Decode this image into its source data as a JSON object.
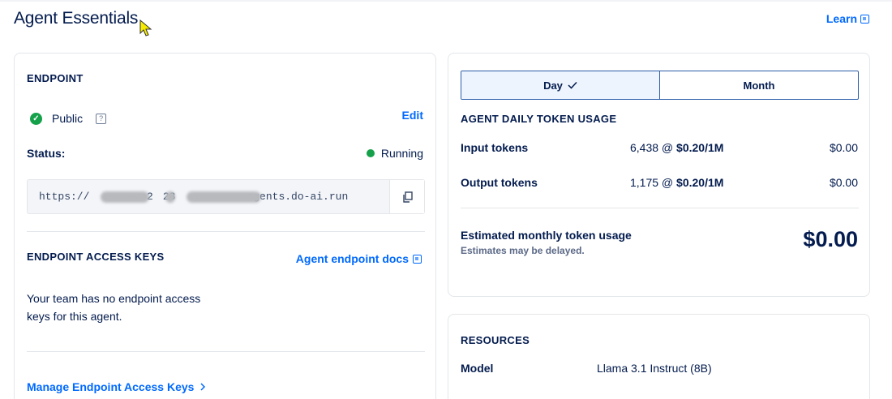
{
  "header": {
    "title": "Agent Essentials",
    "learn_label": "Learn"
  },
  "endpoint": {
    "heading": "ENDPOINT",
    "visibility": "Public",
    "help_icon": "?",
    "edit_label": "Edit",
    "status_label": "Status:",
    "status_value": "Running",
    "url_segments": [
      "https://",
      "ve2",
      "23",
      "agents.do-ai.run"
    ]
  },
  "access_keys": {
    "heading": "ENDPOINT ACCESS KEYS",
    "docs_link": "Agent endpoint docs",
    "empty_line1": "Your team has no endpoint access",
    "empty_line2": "keys for this agent.",
    "manage_link": "Manage Endpoint Access Keys"
  },
  "usage": {
    "toggle": [
      {
        "label": "Day",
        "active": true
      },
      {
        "label": "Month",
        "active": false
      }
    ],
    "heading": "AGENT DAILY TOKEN USAGE",
    "rows": [
      {
        "label": "Input tokens",
        "count": "6,438 @ ",
        "rate": "$0.20/1M",
        "amount": "$0.00"
      },
      {
        "label": "Output tokens",
        "count": "1,175 @ ",
        "rate": "$0.20/1M",
        "amount": "$0.00"
      }
    ],
    "estimate_label": "Estimated monthly token usage",
    "estimate_note": "Estimates may be delayed.",
    "estimate_total": "$0.00"
  },
  "resources": {
    "heading": "RESOURCES",
    "model_label": "Model",
    "model_value": "Llama 3.1 Instruct (8B)"
  },
  "icons": {
    "check": "check-circle-icon",
    "help": "question-icon",
    "status_dot": "status-dot-icon",
    "copy": "copy-icon",
    "external": "external-link-icon",
    "chevron": "chevron-right-icon",
    "checkmark": "checkmark-icon"
  },
  "colors": {
    "accent": "#0069ff",
    "success": "#15a04a",
    "text": "#031b4e"
  }
}
